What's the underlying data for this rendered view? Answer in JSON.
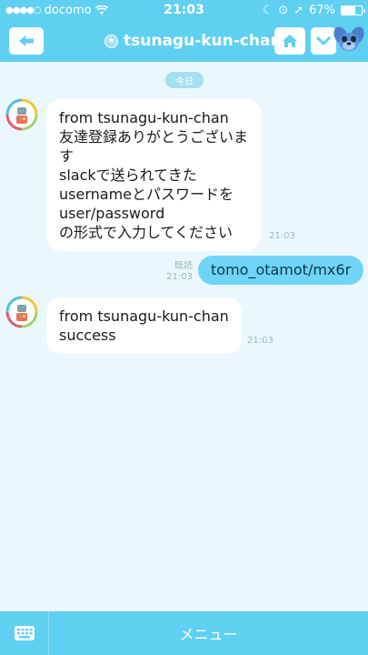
{
  "status_bar": {
    "carrier": "docomo",
    "time": "21:03",
    "battery_pct": "67%",
    "battery_level": 0.67
  },
  "header": {
    "title": "tsunagu-kun-chan",
    "back_icon": "back-arrow-icon",
    "home_icon": "home-icon",
    "chevron_icon": "chevron-down-icon"
  },
  "chat": {
    "date_label": "今日",
    "messages": [
      {
        "direction": "in",
        "lines": [
          "from tsunagu-kun-chan",
          "友達登録ありがとうございま",
          "す",
          "slackで送られてきた",
          "usernameとパスワードを",
          "user/password",
          "の形式で入力してください"
        ],
        "time": "21:03"
      },
      {
        "direction": "out",
        "lines": [
          "tomo_otamot/mx6r"
        ],
        "read": "既読",
        "time": "21:03"
      },
      {
        "direction": "in",
        "lines": [
          "from tsunagu-kun-chan",
          "success"
        ],
        "time": "21:03"
      }
    ]
  },
  "footer": {
    "menu_label": "メニュー",
    "keyboard_icon": "keyboard-icon"
  },
  "colors": {
    "accent": "#5fd0f2",
    "background": "#eaf8fd",
    "outgoing_bubble": "#6fd4f5"
  }
}
